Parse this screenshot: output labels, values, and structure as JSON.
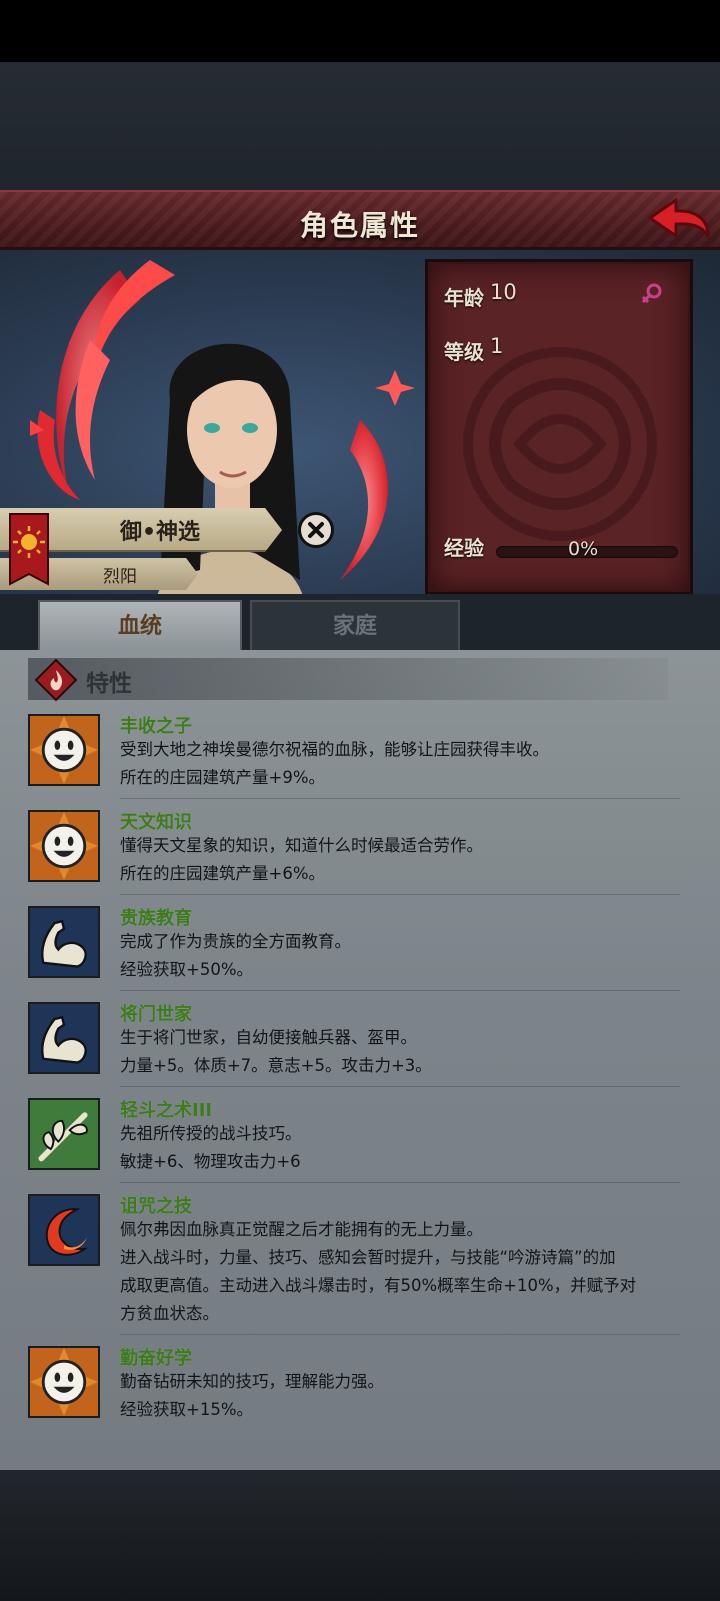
{
  "header": {
    "title": "角色属性",
    "back_icon": "back-arrow-icon"
  },
  "character": {
    "title": "御•神选",
    "subtitle": "烈阳",
    "emblem_icon": "sun-flag-icon"
  },
  "stats": {
    "age_label": "年龄",
    "age_value": "10",
    "level_label": "等级",
    "level_value": "1",
    "xp_label": "经验",
    "xp_value": "0%",
    "xp_fraction": 0,
    "gender_icon": "female-symbol-icon"
  },
  "tabs": [
    {
      "label": "血统",
      "active": true
    },
    {
      "label": "家庭",
      "active": false
    }
  ],
  "section": {
    "title": "特性",
    "icon": "flame-diamond-icon"
  },
  "traits": [
    {
      "name": "丰收之子",
      "icon": "smiley-face-icon",
      "lines": [
        "受到大地之神埃曼德尔祝福的血脉，能够让庄园获得丰收。",
        "所在的庄园建筑产量+9%。"
      ]
    },
    {
      "name": "天文知识",
      "icon": "smiley-face-icon",
      "lines": [
        "懂得天文星象的知识，知道什么时候最适合劳作。",
        "所在的庄园建筑产量+6%。"
      ]
    },
    {
      "name": "贵族教育",
      "icon": "flexed-arm-icon",
      "lines": [
        "完成了作为贵族的全方面教育。",
        "经验获取+50%。"
      ]
    },
    {
      "name": "将门世家",
      "icon": "flexed-arm-icon",
      "lines": [
        "生于将门世家，自幼便接触兵器、盔甲。",
        "力量+5。体质+7。意志+5。攻击力+3。"
      ]
    },
    {
      "name": "轻斗之术III",
      "icon": "leaf-branch-icon",
      "lines": [
        "先祖所传授的战斗技巧。",
        "敏捷+6、物理攻击力+6"
      ]
    },
    {
      "name": "诅咒之技",
      "icon": "crescent-moon-icon",
      "lines": [
        "佩尔弗因血脉真正觉醒之后才能拥有的无上力量。",
        "进入战斗时，力量、技巧、感知会暂时提升，与技能“吟游诗篇”的加",
        "成取更高值。主动进入战斗爆击时，有50%概率生命+10%，并赋予对",
        "方贫血状态。"
      ]
    },
    {
      "name": "勤奋好学",
      "icon": "smiley-face-icon",
      "lines": [
        "勤奋钻研未知的技巧，理解能力强。",
        "经验获取+15%。"
      ]
    }
  ],
  "colors": {
    "trait_name": "#3f7a20",
    "panel": "#5a2326",
    "title_bar": "#4c1c20",
    "flame": "#ff3a3a"
  }
}
